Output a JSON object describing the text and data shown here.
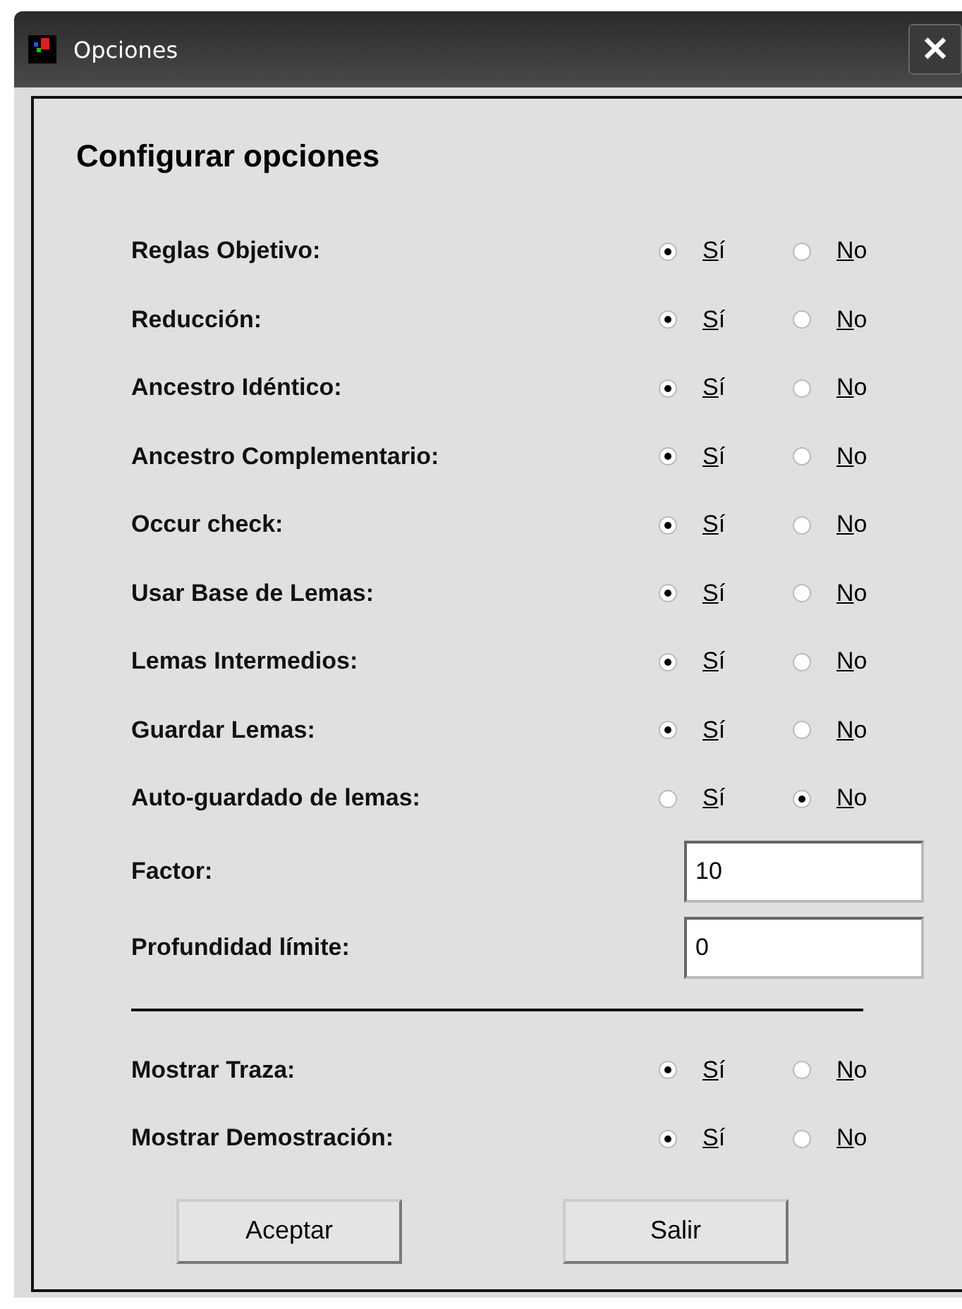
{
  "window": {
    "title": "Opciones",
    "close": "✕"
  },
  "heading": "Configurar opciones",
  "options": [
    {
      "label": "Reglas Objetivo:",
      "choices": [
        {
          "label": "Sí",
          "selected": true
        },
        {
          "label": "No",
          "selected": false
        }
      ]
    },
    {
      "label": "Reducción:",
      "choices": [
        {
          "label": "Sí",
          "selected": true
        },
        {
          "label": "No",
          "selected": false
        }
      ]
    },
    {
      "label": "Ancestro Idéntico:",
      "choices": [
        {
          "label": "Sí",
          "selected": true
        },
        {
          "label": "No",
          "selected": false
        }
      ]
    },
    {
      "label": "Ancestro Complementario:",
      "choices": [
        {
          "label": "Sí",
          "selected": true
        },
        {
          "label": "No",
          "selected": false
        }
      ]
    },
    {
      "label": "Occur check:",
      "choices": [
        {
          "label": "Sí",
          "selected": true
        },
        {
          "label": "No",
          "selected": false
        }
      ]
    },
    {
      "label": "Usar Base de Lemas:",
      "choices": [
        {
          "label": "Sí",
          "selected": true
        },
        {
          "label": "No",
          "selected": false
        }
      ]
    },
    {
      "label": "Lemas Intermedios:",
      "choices": [
        {
          "label": "Sí",
          "selected": true
        },
        {
          "label": "No",
          "selected": false
        }
      ]
    },
    {
      "label": "Guardar Lemas:",
      "choices": [
        {
          "label": "Sí",
          "selected": true
        },
        {
          "label": "No",
          "selected": false
        }
      ]
    },
    {
      "label": "Auto-guardado de lemas:",
      "choices": [
        {
          "label": "Sí",
          "selected": false
        },
        {
          "label": "No",
          "selected": true
        }
      ]
    }
  ],
  "fields": [
    {
      "label": "Factor:",
      "value": "10"
    },
    {
      "label": "Profundidad límite:",
      "value": "0"
    }
  ],
  "display_options": [
    {
      "label": "Mostrar Traza:",
      "choices": [
        {
          "label": "Sí",
          "selected": true
        },
        {
          "label": "No",
          "selected": false
        }
      ]
    },
    {
      "label": "Mostrar Demostración:",
      "choices": [
        {
          "label": "Sí",
          "selected": true
        },
        {
          "label": "No",
          "selected": false
        }
      ]
    }
  ],
  "buttons": [
    "Aceptar",
    "Salir"
  ]
}
